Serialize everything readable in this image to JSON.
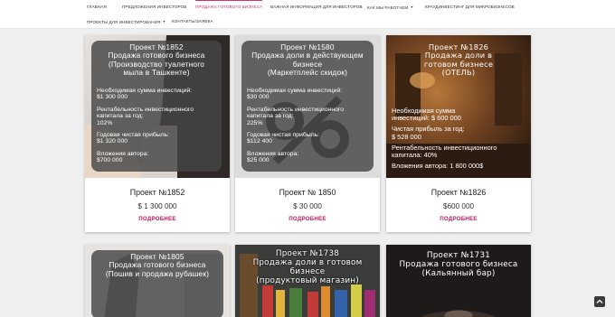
{
  "nav": {
    "items": [
      {
        "label": "Главная"
      },
      {
        "label": "Предложения инвесторов"
      },
      {
        "label": "Продажа готового бизнеса"
      },
      {
        "label": "Важная информация для инвесторов"
      },
      {
        "label": "Как мы работаем"
      },
      {
        "label": "Краудинвестинг для микробизнесов"
      },
      {
        "label": "Проекты для инвестирования"
      },
      {
        "label": "Контакты/Заявка"
      }
    ],
    "active_index": 2
  },
  "cards": [
    {
      "overlay_title": [
        "Проект №1852",
        "Продажа готового бизнеса",
        "(Производство туалетного",
        "мыла в Ташкенте)"
      ],
      "overlay_lines": [
        "Необходимая сумма инвестиций:",
        "$1 300 000",
        "",
        "Рентабельность инвестиционного",
        "капитала за год:",
        "102%",
        "",
        "Годовая чистая прибыль:",
        "$1 320 000",
        "",
        "Вложения автора:",
        "$700 000"
      ],
      "title": "Проект №1852",
      "price": "$ 1 300 000",
      "more": "ПОДРОБНЕЕ"
    },
    {
      "overlay_title": [
        "Проект №1580",
        "Продажа доли в действующем",
        "бизнесе",
        "(Маркетплейс скидок)"
      ],
      "overlay_lines": [
        "Необходимая сумма инвестиций:",
        "$30 000",
        "",
        "Рентабельность инвестиционного",
        "капитала за год:",
        "225%",
        "",
        "Годовая чистая прибыль:",
        "$112 400",
        "",
        "Вложения автора:",
        "$25 000"
      ],
      "title": "Проект № 1850",
      "price": "$ 30 000",
      "more": "ПОДРОБНЕЕ"
    },
    {
      "overlay_title": [
        "Проект №1826",
        "Продажа доли в",
        "готовом бизнесе",
        "(ОТЕЛЬ)"
      ],
      "overlay_lines": [
        "Необходимая сумма",
        "инвестиций: $ 600 000",
        "",
        "Чистая прибыль за год:",
        "$ 528 000",
        "",
        "Рентабельность инвестиционного",
        "капитала: 40%",
        "",
        "Вложения автора: 1 800 000$"
      ],
      "title": "Проект №1826",
      "price": "$600 000",
      "more": "ПОДРОБНЕЕ"
    },
    {
      "overlay_title": [
        "Проект №1805",
        "Продажа готового бизнеса",
        "(Пошив и продажа рубашек)"
      ]
    },
    {
      "overlay_title": [
        "Проект №1738",
        "Продажа доли в готовом бизнесе",
        "(продуктовый магазин)"
      ]
    },
    {
      "overlay_title": [
        "Проект №1731",
        "Продажа готового бизнеса",
        "(Кальянный бар)"
      ]
    }
  ],
  "icons": {
    "scroll_top": "chevron-up-icon"
  },
  "colors": {
    "accent": "#d6336c",
    "more_link": "#c2185b"
  }
}
